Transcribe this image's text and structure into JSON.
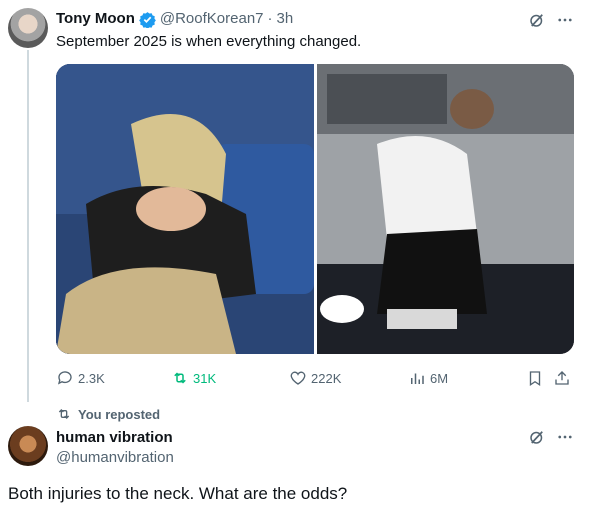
{
  "post": {
    "author_name": "Tony Moon",
    "author_handle": "@RoofKorean7",
    "separator": "·",
    "time": "3h",
    "text": "September 2025 is when everything changed.",
    "media": [
      {
        "icon": "photo-left"
      },
      {
        "icon": "photo-right"
      }
    ],
    "metrics": {
      "replies": "2.3K",
      "reposts": "31K",
      "likes": "222K",
      "views": "6M"
    },
    "colors": {
      "repost_active": "#00ba7c",
      "verified": "#1d9bf0",
      "muted": "#536471"
    }
  },
  "repost_context": {
    "label": "You reposted"
  },
  "reply": {
    "author_name": "human vibration",
    "author_handle": "@humanvibration",
    "text": "Both injuries to the neck. What are the odds?"
  }
}
